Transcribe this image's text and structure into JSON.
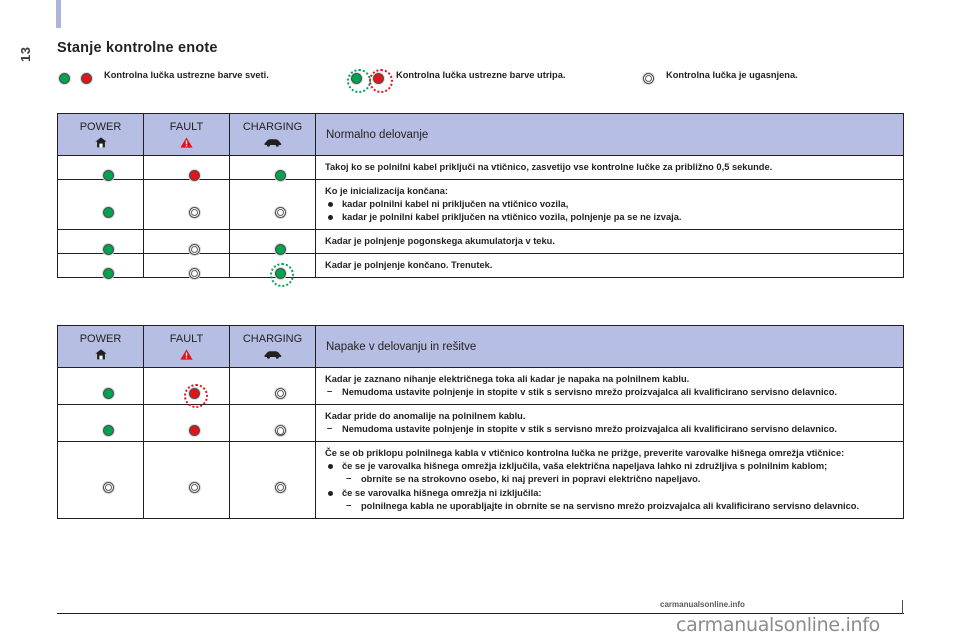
{
  "page": {
    "folio": "13",
    "title": "Stanje kontrolne enote",
    "watermark": "carmanualsonline.info",
    "footer_ghost": "carmanualsonline.info"
  },
  "legend": {
    "items": [
      {
        "label": "Kontrolna lučka ustrezne barve sveti.",
        "lamps": [
          "green-on",
          "red-on"
        ]
      },
      {
        "label": "Kontrolna lučka ustrezne barve utripa.",
        "lamps": [
          "green-blink",
          "red-blink"
        ]
      },
      {
        "label": "Kontrolna lučka je ugasnjena.",
        "lamps": [
          "off"
        ]
      }
    ]
  },
  "tables": [
    {
      "id": "normal-operation",
      "headers": [
        {
          "label": "POWER",
          "icon": "house-icon"
        },
        {
          "label": "FAULT",
          "icon": "warning-triangle-icon"
        },
        {
          "label": "CHARGING",
          "icon": "car-icon"
        }
      ],
      "description_header": "Normalno delovanje",
      "rows": [
        {
          "indicators": [
            "green-on",
            "red-on",
            "green-on"
          ],
          "text": "Takoj ko se polnilni kabel priključi na vtičnico, zasvetijo vse kontrolne lučke za približno 0,5 sekunde.",
          "bullets": [],
          "dashes": []
        },
        {
          "indicators": [
            "green-on",
            "off",
            "off"
          ],
          "text": "Ko je inicializacija končana:",
          "bullets": [
            "kadar polnilni kabel ni priključen na vtičnico vozila,",
            "kadar je polnilni kabel priključen na vtičnico vozila, polnjenje pa se ne izvaja."
          ],
          "dashes": []
        },
        {
          "indicators": [
            "green-on",
            "off",
            "green-on"
          ],
          "text": "Kadar je polnjenje pogonskega akumulatorja v teku.",
          "bullets": [],
          "dashes": []
        },
        {
          "indicators": [
            "green-on",
            "off",
            "green-blink"
          ],
          "text": "Kadar je polnjenje končano. Trenutek.",
          "bullets": [],
          "dashes": []
        }
      ]
    },
    {
      "id": "faults-and-remedies",
      "headers": [
        {
          "label": "POWER",
          "icon": "house-icon"
        },
        {
          "label": "FAULT",
          "icon": "warning-triangle-icon"
        },
        {
          "label": "CHARGING",
          "icon": "car-icon"
        }
      ],
      "description_header": "Napake v delovanju in rešitve",
      "rows": [
        {
          "indicators": [
            "green-on",
            "red-blink",
            "off"
          ],
          "text": "Kadar je zaznano nihanje električnega toka ali kadar je napaka na polnilnem kablu.",
          "bullets": [],
          "dashes": [
            "Nemudoma ustavite polnjenje in stopite v stik s servisno mrežo proizvajalca ali kvalificirano servisno delavnico."
          ]
        },
        {
          "indicators": [
            "green-on",
            "red-on",
            "off"
          ],
          "text": "Kadar pride do anomalije na polnilnem kablu.",
          "bullets": [],
          "dashes": [
            "Nemudoma ustavite polnjenje in stopite v stik s servisno mrežo proizvajalca ali kvalificirano servisno delavnico."
          ]
        },
        {
          "indicators": [
            "off",
            "off",
            "off"
          ],
          "text": "Če se ob priklopu polnilnega kabla v vtičnico kontrolna lučka ne prižge, preverite varovalke hišnega omrežja vtičnice:",
          "bullets": [
            {
              "text": "če se je varovalka hišnega omrežja izključila, vaša električna napeljava lahko ni združljiva s polnilnim kablom;",
              "sub": [
                "obrnite se na strokovno osebo, ki naj preveri in popravi električno napeljavo."
              ]
            },
            {
              "text": "če se varovalka hišnega omrežja ni izključila:",
              "sub": [
                "polnilnega kabla ne uporabljajte in obrnite se na servisno mrežo proizvajalca ali kvalificirano servisno delavnico."
              ]
            }
          ],
          "dashes": []
        }
      ]
    }
  ],
  "colors": {
    "header_bg": "#b6bfe3",
    "green": "#00a450",
    "red": "#e3131b",
    "text": "#231f20",
    "accent_bar": "#aab4dd"
  }
}
